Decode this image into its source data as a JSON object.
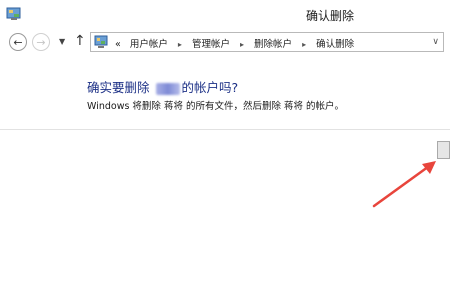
{
  "window": {
    "title": "确认删除"
  },
  "navigation": {
    "back_icon": "back-arrow",
    "forward_icon": "forward-arrow",
    "up_icon": "up-arrow",
    "breadcrumb_overflow": "«",
    "breadcrumbs": [
      "用户帐户",
      "管理帐户",
      "删除帐户",
      "确认删除"
    ]
  },
  "main": {
    "question_prefix": "确实要删除",
    "question_suffix": "的帐户吗?",
    "description": "Windows 将删除 蒋将 的所有文件，然后删除 蒋将 的帐户。"
  },
  "colors": {
    "heading": "#1e3287",
    "annotation_arrow": "#e8453c"
  }
}
